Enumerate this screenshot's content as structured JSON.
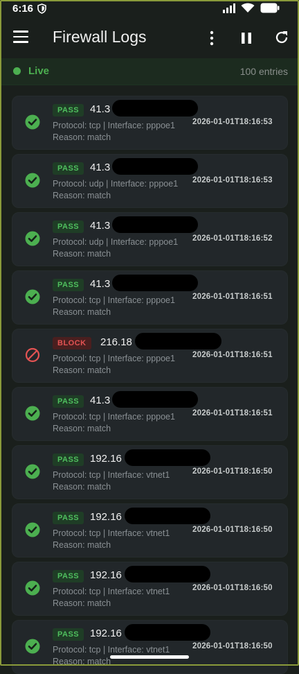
{
  "status_bar": {
    "time": "6:16"
  },
  "app_bar": {
    "title": "Firewall Logs"
  },
  "live_bar": {
    "label": "Live",
    "entries": "100 entries"
  },
  "colors": {
    "pass": "#4caf50",
    "block": "#e35353",
    "background": "#1a1f1c",
    "card": "#22272a"
  },
  "logs": [
    {
      "action": "PASS",
      "ip": "41.3",
      "protocol_line": "Protocol: tcp | Interface: pppoe1",
      "reason": "Reason: match",
      "timestamp": "2026-01-01T18:16:53",
      "icon": "check-circle-icon"
    },
    {
      "action": "PASS",
      "ip": "41.3",
      "protocol_line": "Protocol: udp | Interface: pppoe1",
      "reason": "Reason: match",
      "timestamp": "2026-01-01T18:16:53",
      "icon": "check-circle-icon"
    },
    {
      "action": "PASS",
      "ip": "41.3",
      "protocol_line": "Protocol: udp | Interface: pppoe1",
      "reason": "Reason: match",
      "timestamp": "2026-01-01T18:16:52",
      "icon": "check-circle-icon"
    },
    {
      "action": "PASS",
      "ip": "41.3",
      "protocol_line": "Protocol: tcp | Interface: pppoe1",
      "reason": "Reason: match",
      "timestamp": "2026-01-01T18:16:51",
      "icon": "check-circle-icon"
    },
    {
      "action": "BLOCK",
      "ip": "216.18",
      "protocol_line": "Protocol: tcp | Interface: pppoe1",
      "reason": "Reason: match",
      "timestamp": "2026-01-01T18:16:51",
      "icon": "block-icon"
    },
    {
      "action": "PASS",
      "ip": "41.3",
      "protocol_line": "Protocol: tcp | Interface: pppoe1",
      "reason": "Reason: match",
      "timestamp": "2026-01-01T18:16:51",
      "icon": "check-circle-icon"
    },
    {
      "action": "PASS",
      "ip": "192.16",
      "protocol_line": "Protocol: tcp | Interface: vtnet1",
      "reason": "Reason: match",
      "timestamp": "2026-01-01T18:16:50",
      "icon": "check-circle-icon"
    },
    {
      "action": "PASS",
      "ip": "192.16",
      "protocol_line": "Protocol: tcp | Interface: vtnet1",
      "reason": "Reason: match",
      "timestamp": "2026-01-01T18:16:50",
      "icon": "check-circle-icon"
    },
    {
      "action": "PASS",
      "ip": "192.16",
      "protocol_line": "Protocol: tcp | Interface: vtnet1",
      "reason": "Reason: match",
      "timestamp": "2026-01-01T18:16:50",
      "icon": "check-circle-icon"
    },
    {
      "action": "PASS",
      "ip": "192.16",
      "protocol_line": "Protocol: tcp | Interface: vtnet1",
      "reason": "Reason: match",
      "timestamp": "2026-01-01T18:16:50",
      "icon": "check-circle-icon"
    }
  ]
}
